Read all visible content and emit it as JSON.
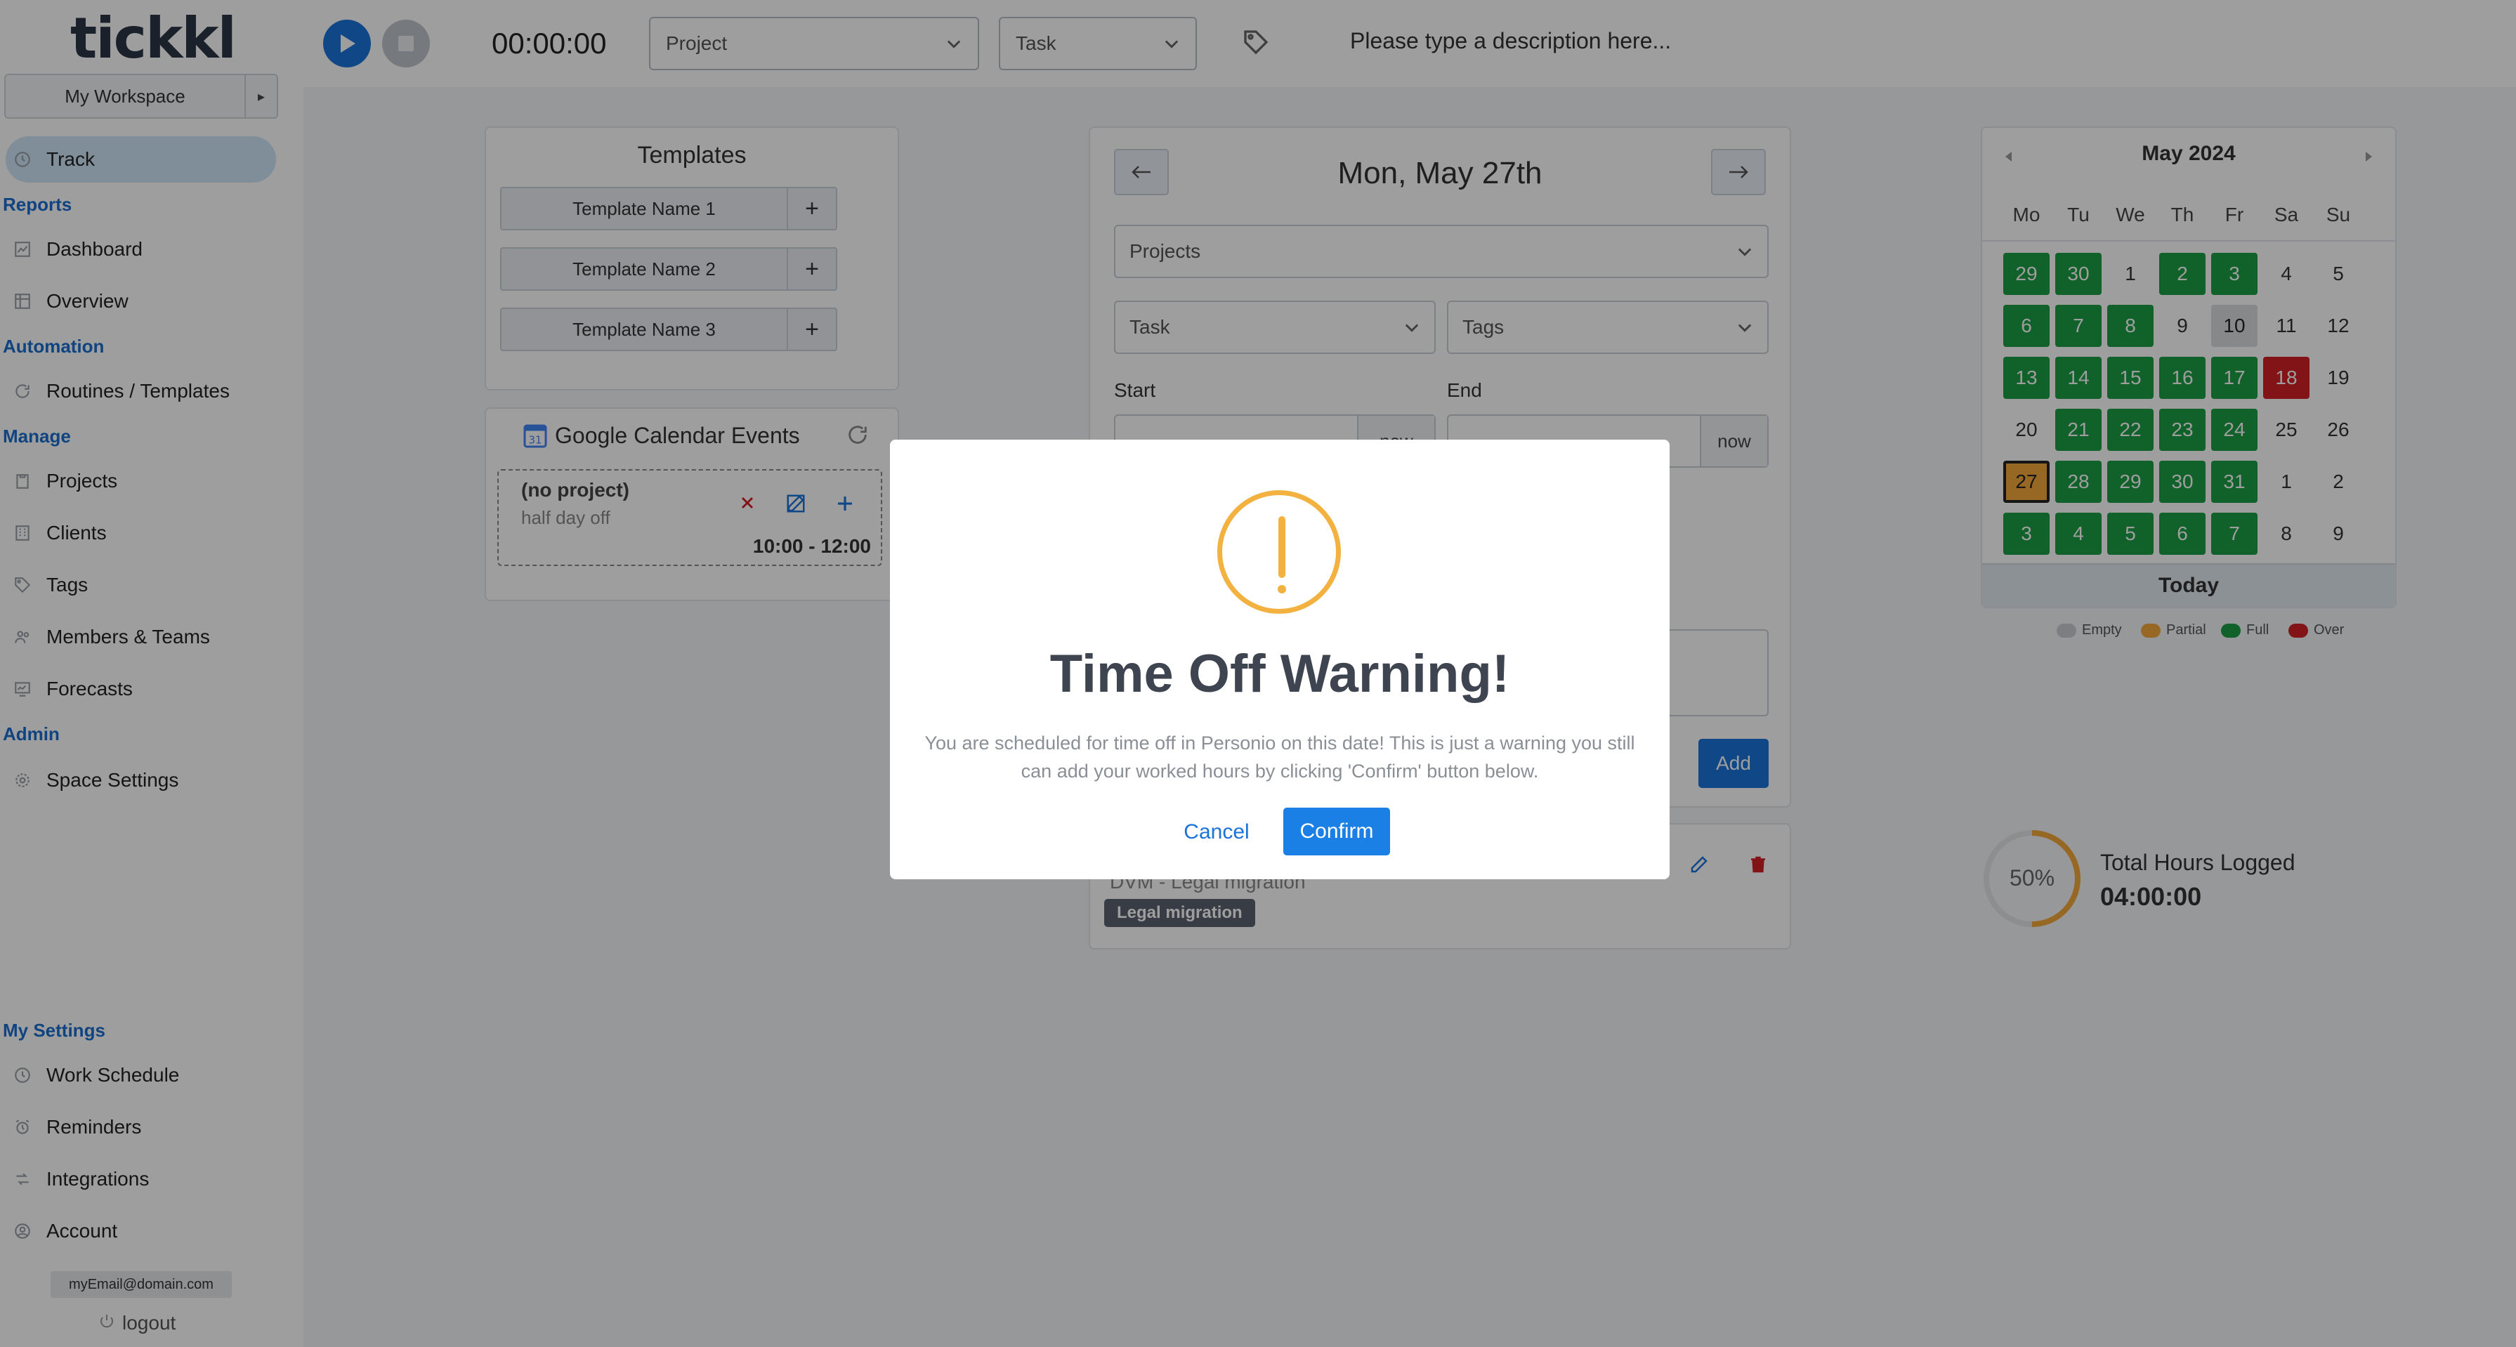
{
  "app": {
    "logo": "tickkl"
  },
  "sidebar": {
    "workspace": "My Workspace",
    "track": "Track",
    "sections": {
      "reports": "Reports",
      "automation": "Automation",
      "manage": "Manage",
      "admin": "Admin",
      "my_settings": "My Settings"
    },
    "items": {
      "dashboard": "Dashboard",
      "overview": "Overview",
      "routines": "Routines / Templates",
      "projects": "Projects",
      "clients": "Clients",
      "tags": "Tags",
      "members": "Members & Teams",
      "forecasts": "Forecasts",
      "space_settings": "Space Settings",
      "work_schedule": "Work Schedule",
      "reminders": "Reminders",
      "integrations": "Integrations",
      "account": "Account"
    },
    "email": "myEmail@domain.com",
    "logout": "logout"
  },
  "topbar": {
    "timer": "00:00:00",
    "project_placeholder": "Project",
    "task_placeholder": "Task",
    "description_placeholder": "Please type a description here..."
  },
  "templates": {
    "title": "Templates",
    "items": [
      "Template Name 1",
      "Template Name 2",
      "Template Name 3"
    ],
    "plus": "+"
  },
  "gcal": {
    "title": "Google Calendar Events",
    "event": {
      "project": "(no project)",
      "description": "half day off",
      "time": "10:00 - 12:00"
    }
  },
  "entry": {
    "date": "Mon, May 27th",
    "projects_placeholder": "Projects",
    "task_placeholder": "Task",
    "tags_placeholder": "Tags",
    "start_label": "Start",
    "end_label": "End",
    "now_label": "now",
    "add_label": "Add",
    "existing_entry_text": "DVM - Legal migration",
    "existing_entry_tag": "Legal migration"
  },
  "calendar": {
    "month": "May 2024",
    "weekdays": [
      "Mo",
      "Tu",
      "We",
      "Th",
      "Fr",
      "Sa",
      "Su"
    ],
    "weeks": [
      [
        {
          "d": "29",
          "s": "full"
        },
        {
          "d": "30",
          "s": "full"
        },
        {
          "d": "1",
          "s": ""
        },
        {
          "d": "2",
          "s": "full"
        },
        {
          "d": "3",
          "s": "full"
        },
        {
          "d": "4",
          "s": ""
        },
        {
          "d": "5",
          "s": ""
        }
      ],
      [
        {
          "d": "6",
          "s": "full"
        },
        {
          "d": "7",
          "s": "full"
        },
        {
          "d": "8",
          "s": "full"
        },
        {
          "d": "9",
          "s": ""
        },
        {
          "d": "10",
          "s": "empty"
        },
        {
          "d": "11",
          "s": ""
        },
        {
          "d": "12",
          "s": ""
        }
      ],
      [
        {
          "d": "13",
          "s": "full"
        },
        {
          "d": "14",
          "s": "full"
        },
        {
          "d": "15",
          "s": "full"
        },
        {
          "d": "16",
          "s": "full"
        },
        {
          "d": "17",
          "s": "full"
        },
        {
          "d": "18",
          "s": "over"
        },
        {
          "d": "19",
          "s": ""
        }
      ],
      [
        {
          "d": "20",
          "s": ""
        },
        {
          "d": "21",
          "s": "full"
        },
        {
          "d": "22",
          "s": "full"
        },
        {
          "d": "23",
          "s": "full"
        },
        {
          "d": "24",
          "s": "full"
        },
        {
          "d": "25",
          "s": ""
        },
        {
          "d": "26",
          "s": ""
        }
      ],
      [
        {
          "d": "27",
          "s": "partial"
        },
        {
          "d": "28",
          "s": "full"
        },
        {
          "d": "29",
          "s": "full"
        },
        {
          "d": "30",
          "s": "full"
        },
        {
          "d": "31",
          "s": "full"
        },
        {
          "d": "1",
          "s": ""
        },
        {
          "d": "2",
          "s": ""
        }
      ],
      [
        {
          "d": "3",
          "s": "full"
        },
        {
          "d": "4",
          "s": "full"
        },
        {
          "d": "5",
          "s": "full"
        },
        {
          "d": "6",
          "s": "full"
        },
        {
          "d": "7",
          "s": "full"
        },
        {
          "d": "8",
          "s": ""
        },
        {
          "d": "9",
          "s": ""
        }
      ]
    ],
    "today": "Today",
    "legend": [
      {
        "label": "Empty",
        "color": "#c8ccd1"
      },
      {
        "label": "Partial",
        "color": "#f3a83b"
      },
      {
        "label": "Full",
        "color": "#1b9d44"
      },
      {
        "label": "Over",
        "color": "#d21f25"
      }
    ]
  },
  "summary": {
    "percent": "50%",
    "progress_fraction": 0.5,
    "label": "Total Hours Logged",
    "value": "04:00:00"
  },
  "modal": {
    "title": "Time Off Warning!",
    "text": "You are scheduled for time off in Personio on this date! This is just a warning you still can add your worked hours by clicking 'Confirm' button below.",
    "cancel": "Cancel",
    "confirm": "Confirm"
  },
  "colors": {
    "accent": "#1a73d8",
    "warning": "#f3b13f",
    "section_heading": "#1a6fd1"
  }
}
